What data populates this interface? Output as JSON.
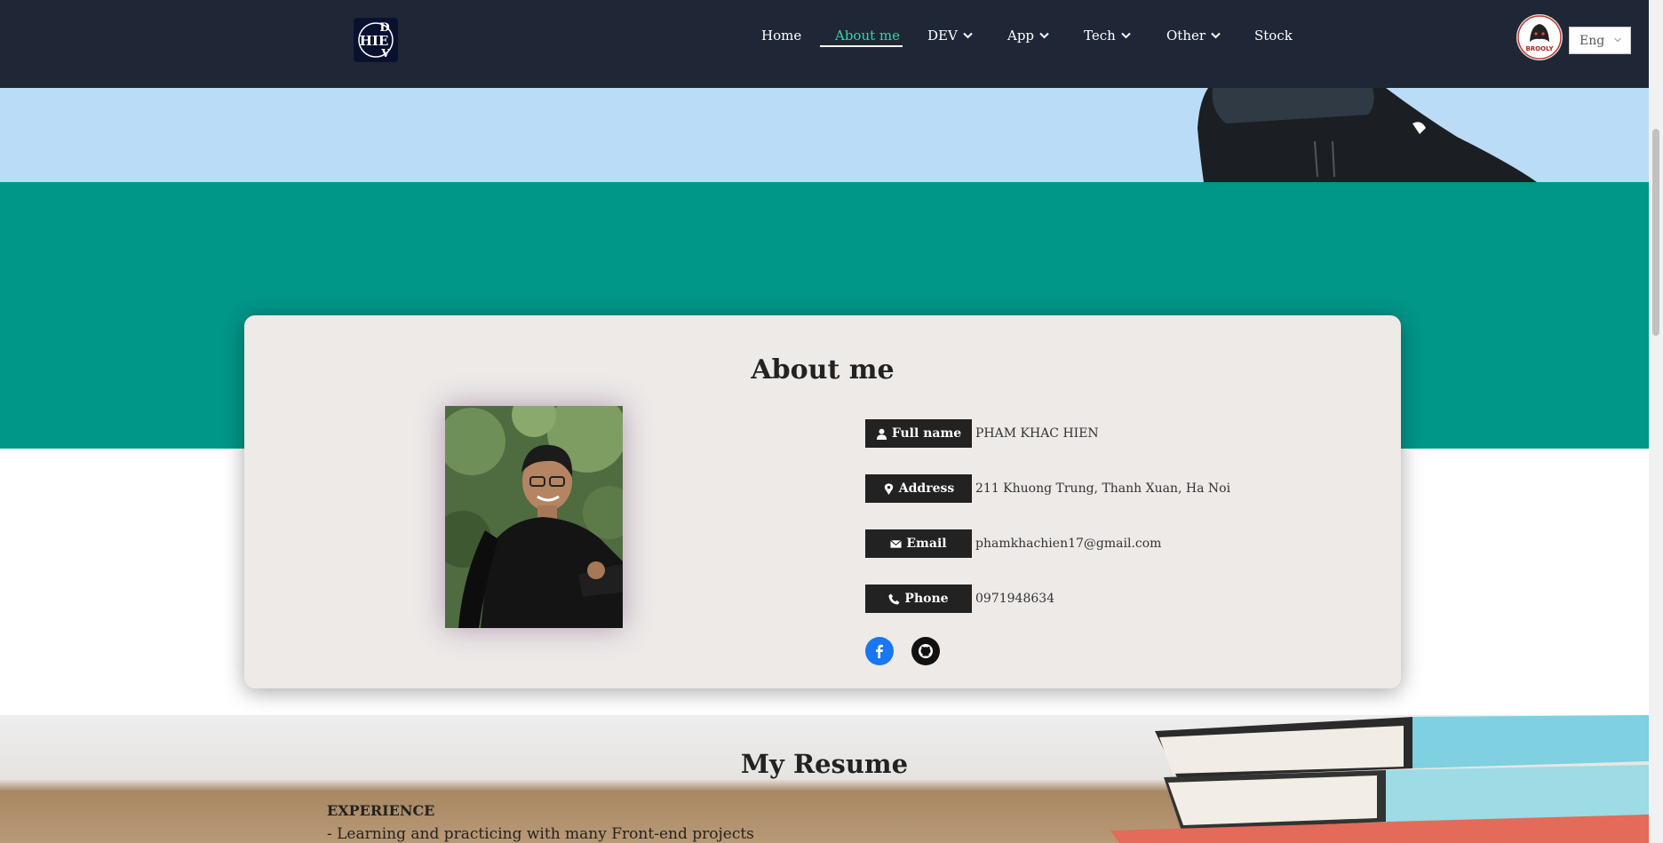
{
  "header": {
    "logo_letters": {
      "top": "D",
      "middle": "HIE",
      "bottom": "V"
    },
    "nav": [
      {
        "label": "Home",
        "dropdown": false,
        "active": false
      },
      {
        "label": "About me",
        "dropdown": false,
        "active": true
      },
      {
        "label": "DEV",
        "dropdown": true,
        "active": false
      },
      {
        "label": "App",
        "dropdown": true,
        "active": false
      },
      {
        "label": "Tech",
        "dropdown": true,
        "active": false
      },
      {
        "label": "Other",
        "dropdown": true,
        "active": false
      },
      {
        "label": "Stock",
        "dropdown": false,
        "active": false
      }
    ],
    "avatar_text": "BROOLY",
    "language": "Eng"
  },
  "about": {
    "title": "About me",
    "fields": [
      {
        "label": "Full name",
        "icon": "user-icon",
        "value": "PHAM KHAC HIEN"
      },
      {
        "label": "Address",
        "icon": "map-marker-icon",
        "value": "211 Khuong Trung, Thanh Xuan, Ha Noi"
      },
      {
        "label": "Email",
        "icon": "envelope-icon",
        "value": "phamkhachien17@gmail.com"
      },
      {
        "label": "Phone",
        "icon": "phone-icon",
        "value": "0971948634"
      }
    ],
    "social": [
      {
        "name": "facebook-icon",
        "color": "#1877f2"
      },
      {
        "name": "github-icon",
        "color": "#111111"
      }
    ]
  },
  "resume": {
    "title": "My Resume",
    "experience_heading": "EXPERIENCE",
    "experience_line": "- Learning and practicing with many Front-end projects"
  },
  "colors": {
    "header_bg": "#1f2737",
    "nav_active": "#36d6a0",
    "hero_strip": "#bbdcf6",
    "teal_band": "#009688",
    "card_bg": "#edeae8",
    "label_bg": "#222222"
  }
}
